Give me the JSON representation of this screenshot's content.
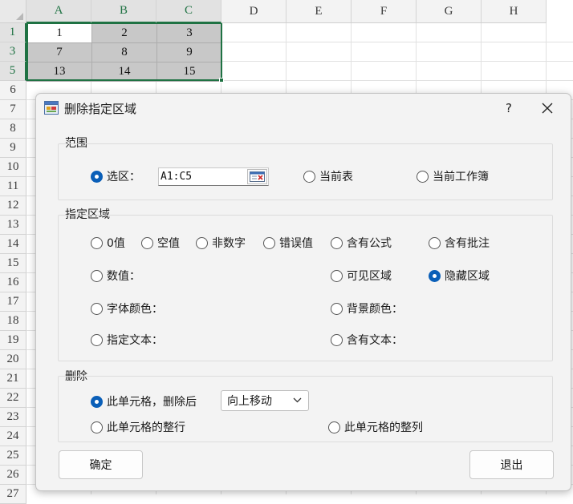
{
  "sheet": {
    "columns": [
      "A",
      "B",
      "C",
      "D",
      "E",
      "F",
      "G",
      "H"
    ],
    "rows": [
      "1",
      "3",
      "5",
      "6",
      "7",
      "8",
      "9",
      "10",
      "11",
      "12",
      "13",
      "14",
      "15",
      "16",
      "17",
      "18",
      "19",
      "20",
      "21",
      "22",
      "23",
      "24",
      "25",
      "26",
      "27"
    ],
    "cells": [
      [
        "1",
        "2",
        "3"
      ],
      [
        "7",
        "8",
        "9"
      ],
      [
        "13",
        "14",
        "15"
      ]
    ]
  },
  "dialog": {
    "title": "删除指定区域",
    "help": "?",
    "scope": {
      "label": "范围",
      "selection_label": "选区：",
      "range_value": "A1:C5",
      "current_sheet": "当前表",
      "current_workbook": "当前工作簿",
      "selected": "selection"
    },
    "area": {
      "label": "指定区域",
      "zero": "0值",
      "empty": "空值",
      "non_numeric": "非数字",
      "error": "错误值",
      "formula": "含有公式",
      "comment": "含有批注",
      "number": "数值：",
      "visible": "可见区域",
      "hidden": "隐藏区域",
      "font_color": "字体颜色：",
      "bg_color": "背景颜色：",
      "text": "指定文本：",
      "contains_text": "含有文本：",
      "selected": "hidden"
    },
    "delete": {
      "label": "删除",
      "cell_then": "此单元格，删除后",
      "shift_value": "向上移动",
      "entire_row": "此单元格的整行",
      "entire_col": "此单元格的整列",
      "selected": "cell"
    },
    "ok": "确定",
    "exit": "退出"
  },
  "colors": {
    "accent": "#0a5fb8",
    "selection": "#1f7243",
    "cell_fill": "#c8c8c8"
  },
  "icons": {
    "app": "app-window-icon",
    "close": "close-icon",
    "picker": "range-picker-icon",
    "dropdown": "chevron-down-icon"
  }
}
